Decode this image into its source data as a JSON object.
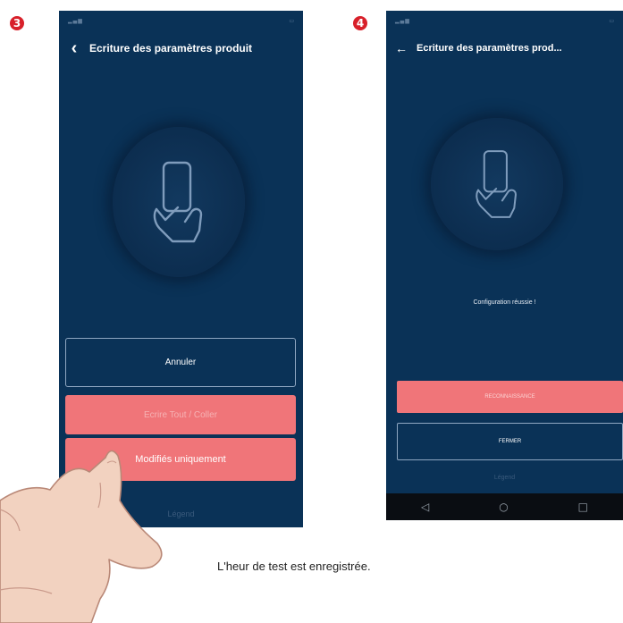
{
  "steps": {
    "left": "3",
    "right": "4"
  },
  "left_screen": {
    "title": "Ecriture des paramètres produit",
    "buttons": {
      "cancel": "Annuler",
      "write_all": "Ecrire Tout / Coller",
      "modified_only": "Modifiés uniquement"
    },
    "legend": "Légend"
  },
  "right_screen": {
    "title": "Ecriture des paramètres prod...",
    "message": "Configuration réussie !",
    "buttons": {
      "recognize": "RECONNAISSANCE",
      "close": "FERMER"
    },
    "legend": "Légend"
  },
  "caption": "L'heur de test est enregistrée.",
  "icons": [
    "back-arrow-icon",
    "phone-hand-icon",
    "android-back-icon",
    "android-home-icon",
    "android-recents-icon"
  ],
  "colors": {
    "screen_bg": "#0a3257",
    "accent": "#f07579",
    "badge": "#d8202a"
  }
}
